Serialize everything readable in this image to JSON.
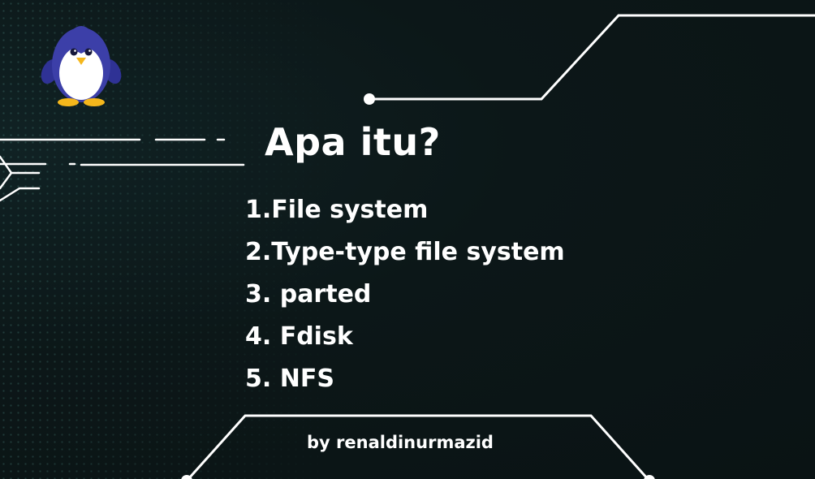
{
  "slide": {
    "title": "Apa itu?",
    "agenda_items": [
      "1.File system",
      "2.Type-type file system",
      "3. parted",
      "4. Fdisk",
      "5. NFS"
    ],
    "author": "by renaldinurmazid"
  },
  "mascot": {
    "icon": "penguin-icon"
  },
  "colors": {
    "background": "#0b1516",
    "text": "#ffffff",
    "circuit_lines": "#ffffff",
    "dot_pattern": "#5aa096",
    "mascot_body": "#3c3fa8",
    "mascot_feet": "#f5b71c"
  }
}
